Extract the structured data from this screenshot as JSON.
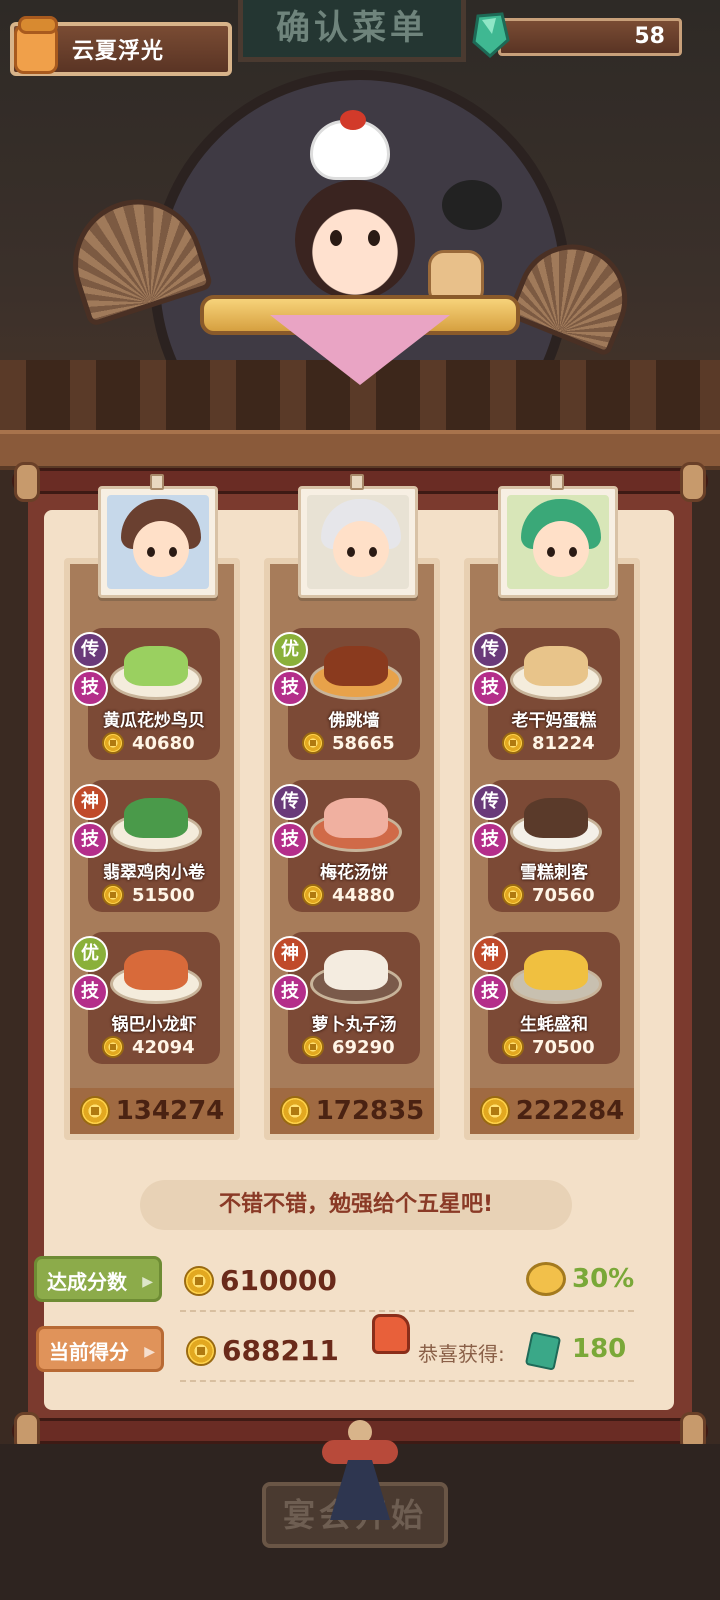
{
  "header": {
    "player_name": "云夏浮光",
    "title": "确认菜单",
    "gems": "58"
  },
  "columns": [
    {
      "total": "134274",
      "dishes": [
        {
          "rank": "传",
          "tech": "技",
          "name": "黄瓜花炒鸟贝",
          "score": "40680"
        },
        {
          "rank": "神",
          "tech": "技",
          "name": "翡翠鸡肉小卷",
          "score": "51500"
        },
        {
          "rank": "优",
          "tech": "技",
          "name": "锅巴小龙虾",
          "score": "42094"
        }
      ]
    },
    {
      "total": "172835",
      "dishes": [
        {
          "rank": "优",
          "tech": "技",
          "name": "佛跳墙",
          "score": "58665"
        },
        {
          "rank": "传",
          "tech": "技",
          "name": "梅花汤饼",
          "score": "44880"
        },
        {
          "rank": "神",
          "tech": "技",
          "name": "萝卜丸子汤",
          "score": "69290"
        }
      ]
    },
    {
      "total": "222284",
      "dishes": [
        {
          "rank": "传",
          "tech": "技",
          "name": "老干妈蛋糕",
          "score": "81224"
        },
        {
          "rank": "传",
          "tech": "技",
          "name": "雪糕刺客",
          "score": "70560"
        },
        {
          "rank": "神",
          "tech": "技",
          "name": "生蚝盛和",
          "score": "70500"
        }
      ]
    }
  ],
  "comment": "不错不错，勉强给个五星吧!",
  "target": {
    "label": "达成分数",
    "value": "610000",
    "percent": "30%"
  },
  "current": {
    "label": "当前得分",
    "value": "688211"
  },
  "reward": {
    "label": "恭喜获得:",
    "value": "180"
  },
  "start_button": "宴会开始",
  "colors": {
    "accent_green": "#7aa838",
    "panel_bg": "#f3e0c8",
    "frame_red": "#7b3a2e"
  }
}
